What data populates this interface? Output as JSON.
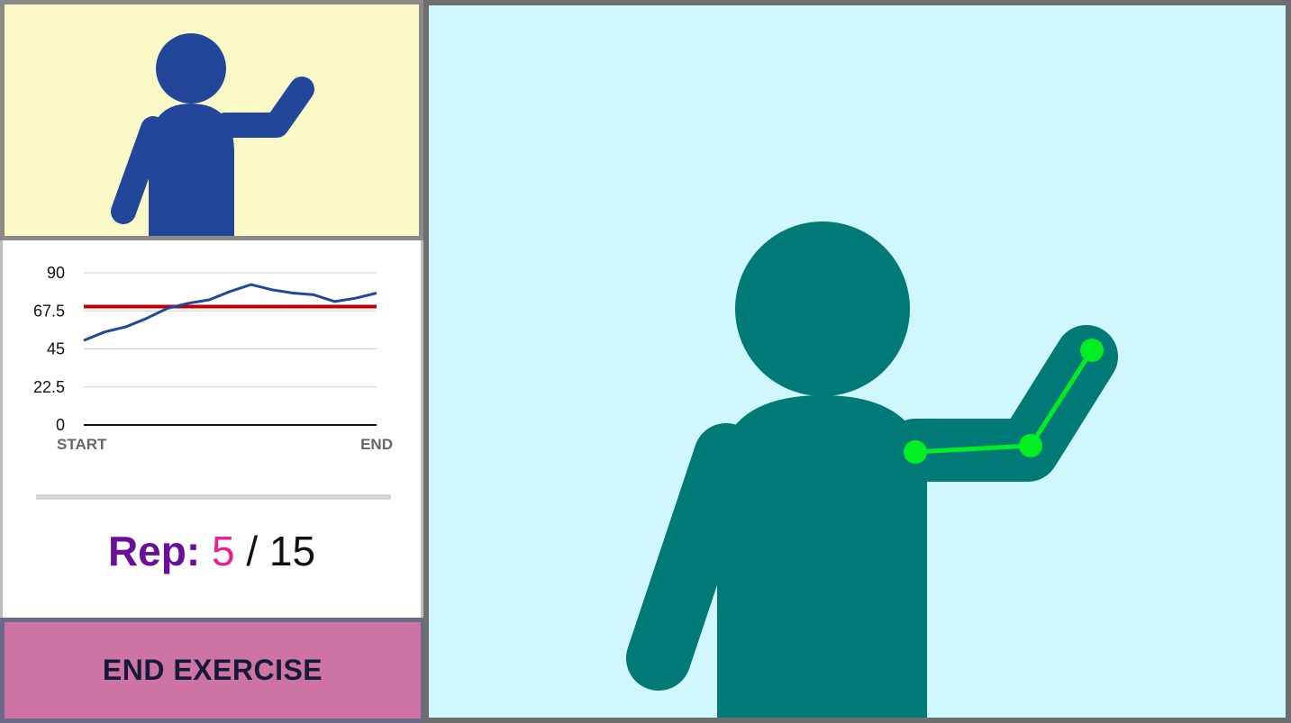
{
  "reference": {
    "title": "",
    "figure_color": "#22479a",
    "background": "#fbf9c8"
  },
  "chart_data": {
    "type": "line",
    "title": "",
    "xlabel": "",
    "ylabel": "",
    "x_tick_labels": [
      "START",
      "END"
    ],
    "y_ticks": [
      "90",
      "67.5",
      "45",
      "22.5",
      "0"
    ],
    "ylim": [
      0,
      90
    ],
    "grid": true,
    "series": [
      {
        "color": "#22479a",
        "values": [
          50,
          55,
          58,
          63,
          69,
          72,
          74,
          79,
          83,
          80,
          78,
          77,
          73,
          75,
          78
        ]
      }
    ],
    "threshold": {
      "value": 70,
      "color": "#c00000"
    }
  },
  "rep": {
    "label": "Rep:",
    "current": "5",
    "separator": "/",
    "total": "15"
  },
  "end_button": {
    "label": "END EXERCISE",
    "color": "#cd74a4"
  },
  "camera": {
    "background": "#cff7fd",
    "person_color": "#007a76",
    "skeleton_color": "#00ee22"
  }
}
